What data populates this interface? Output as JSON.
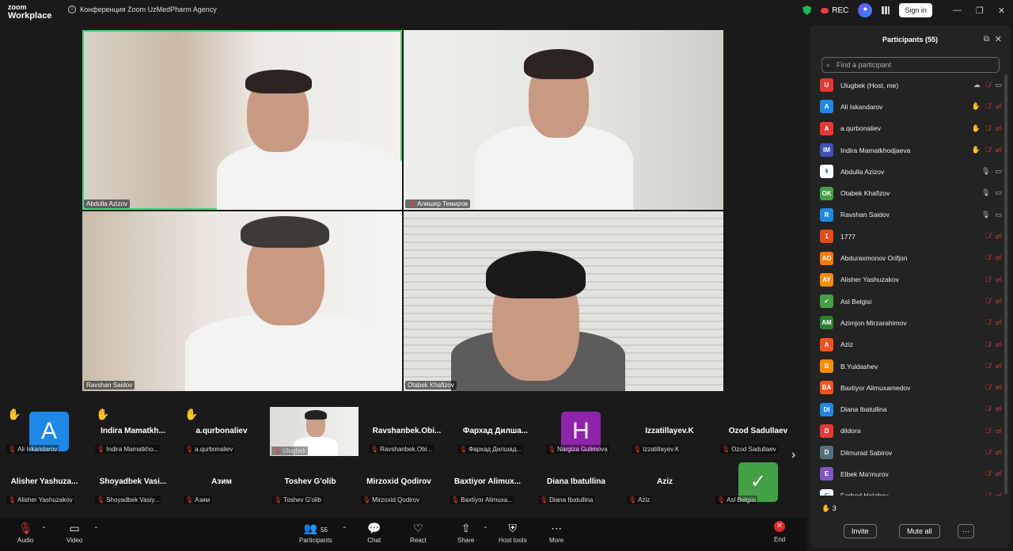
{
  "titlebar": {
    "logo_line1": "zoom",
    "logo_line2": "Workplace",
    "meeting_title": "Конференция Zoom UzMedPharm Agency",
    "rec_label": "REC",
    "signin_label": "Sign in",
    "minimize": "—",
    "restore": "❐",
    "close": "✕"
  },
  "stage": {
    "tiles": [
      {
        "name": "Abdulla Azizov",
        "muted": false,
        "active": true
      },
      {
        "name": "Алишер Темиров",
        "muted": true,
        "active": false
      },
      {
        "name": "Ravshan Saidov",
        "muted": false,
        "active": false
      },
      {
        "name": "Otabek Khafizov",
        "muted": false,
        "active": false
      }
    ]
  },
  "gallery": {
    "row1": [
      {
        "label": "Ali Iskandarov",
        "hand": true,
        "avatar_letter": "A",
        "avatar_color": "#1e88e5"
      },
      {
        "big": "Indira  Mamatkh...",
        "label": "Indira Mamatkho...",
        "hand": true
      },
      {
        "big": "a.qurbonaliev",
        "label": "a.qurbonaliev",
        "hand": true
      },
      {
        "label": "Ulugbek",
        "video": true
      },
      {
        "big": "Ravshanbek.Obi...",
        "label": "Ravshanbek.Obi..."
      },
      {
        "big": "Фархад  Дилша...",
        "label": "Фархад Дилшад..."
      },
      {
        "label": "Nargiza Gulimova",
        "avatar_letter": "H",
        "avatar_color": "#8e24aa"
      },
      {
        "big": "Izzatillayev.K",
        "label": "Izzatillayev.K"
      },
      {
        "big": "Ozod Sadullaev",
        "label": "Ozod Sadullaev"
      }
    ],
    "row2": [
      {
        "big": "Alisher  Yashuza...",
        "label": "Alisher Yashuzakov"
      },
      {
        "big": "Shoyadbek  Vasi...",
        "label": "Shoyadbek Vasiy..."
      },
      {
        "big": "Азим",
        "label": "Азим"
      },
      {
        "big": "Toshev G'olib",
        "label": "Toshev G'olib"
      },
      {
        "big": "Mirzoxid Qodirov",
        "label": "Mirzoxid Qodirov"
      },
      {
        "big": "Baxtiyor  Alimux...",
        "label": "Baxtiyor Alimuxa..."
      },
      {
        "big": "Diana Ibatullina",
        "label": "Diana Ibatullina"
      },
      {
        "big": "Aziz",
        "label": "Aziz"
      },
      {
        "label": "Asl Belgisi",
        "avatar_color": "#43a047"
      }
    ],
    "next": "›"
  },
  "toolbar": {
    "audio": "Audio",
    "video": "Video",
    "participants": "Participants",
    "participants_count": "55",
    "chat": "Chat",
    "react": "React",
    "share": "Share",
    "host_tools": "Host tools",
    "more": "More",
    "end": "End"
  },
  "panel": {
    "title": "Participants (55)",
    "search_placeholder": "Find a participant",
    "participants": [
      {
        "initials": "U",
        "color": "#e53935",
        "name": "Ulugbek (Host, me)",
        "hand": false,
        "cloud": true,
        "mic": "red",
        "cam": "grey"
      },
      {
        "initials": "A",
        "color": "#1e88e5",
        "name": "Ali Iskandarov",
        "hand": true,
        "mic": "red",
        "cam": "red"
      },
      {
        "initials": "A",
        "color": "#e53935",
        "name": "a.qurbonaliev",
        "hand": true,
        "mic": "red",
        "cam": "red"
      },
      {
        "initials": "IM",
        "color": "#3f51b5",
        "name": "Indira Mamatkhodjaeva",
        "hand": true,
        "mic": "red",
        "cam": "red"
      },
      {
        "initials": "⚕",
        "color": "#ffffff",
        "name": "Abdulla Azizov",
        "hand": false,
        "mic": "grey",
        "cam": "grey"
      },
      {
        "initials": "OK",
        "color": "#43a047",
        "name": "Otabek Khafizov",
        "hand": false,
        "mic": "grey",
        "cam": "grey"
      },
      {
        "initials": "R",
        "color": "#1e88e5",
        "name": "Ravshan Saidov",
        "hand": false,
        "mic": "grey",
        "cam": "grey"
      },
      {
        "initials": "1",
        "color": "#e64a19",
        "name": "1777",
        "hand": false,
        "mic": "red",
        "cam": "red"
      },
      {
        "initials": "AO",
        "color": "#f57c00",
        "name": "Abduraxmonov Orifjon",
        "hand": false,
        "mic": "red",
        "cam": "red"
      },
      {
        "initials": "AY",
        "color": "#fb8c00",
        "name": "Alisher Yashuzakov",
        "hand": false,
        "mic": "red",
        "cam": "red"
      },
      {
        "initials": "✓",
        "color": "#43a047",
        "name": "Asl Belgisi",
        "hand": false,
        "mic": "red",
        "cam": "red"
      },
      {
        "initials": "AM",
        "color": "#2e7d32",
        "name": "Azimjon Mirzarahimov",
        "hand": false,
        "mic": "red",
        "cam": "red"
      },
      {
        "initials": "A",
        "color": "#f4511e",
        "name": "Aziz",
        "hand": false,
        "mic": "red",
        "cam": "red"
      },
      {
        "initials": "B",
        "color": "#fb8c00",
        "name": "B.Yuldashev",
        "hand": false,
        "mic": "red",
        "cam": "red"
      },
      {
        "initials": "BA",
        "color": "#f4511e",
        "name": "Baxtiyor Alimuxamedov",
        "hand": false,
        "mic": "red",
        "cam": "red"
      },
      {
        "initials": "DI",
        "color": "#1e88e5",
        "name": "Diana Ibatullina",
        "hand": false,
        "mic": "red",
        "cam": "red"
      },
      {
        "initials": "D",
        "color": "#e53935",
        "name": "dildora",
        "hand": false,
        "mic": "red",
        "cam": "red"
      },
      {
        "initials": "D",
        "color": "#546e7a",
        "name": "Dilmurad Sabirov",
        "hand": false,
        "mic": "red",
        "cam": "red"
      },
      {
        "initials": "E",
        "color": "#7e57c2",
        "name": "Elbek Ma'murov",
        "hand": false,
        "mic": "red",
        "cam": "red"
      },
      {
        "initials": "F",
        "color": "#ffffff",
        "name": "Farhod Halabov",
        "hand": false,
        "mic": "red",
        "cam": "red"
      }
    ],
    "hand_count": "3",
    "invite_label": "Invite",
    "mute_all_label": "Mute all",
    "more_label": "···"
  }
}
